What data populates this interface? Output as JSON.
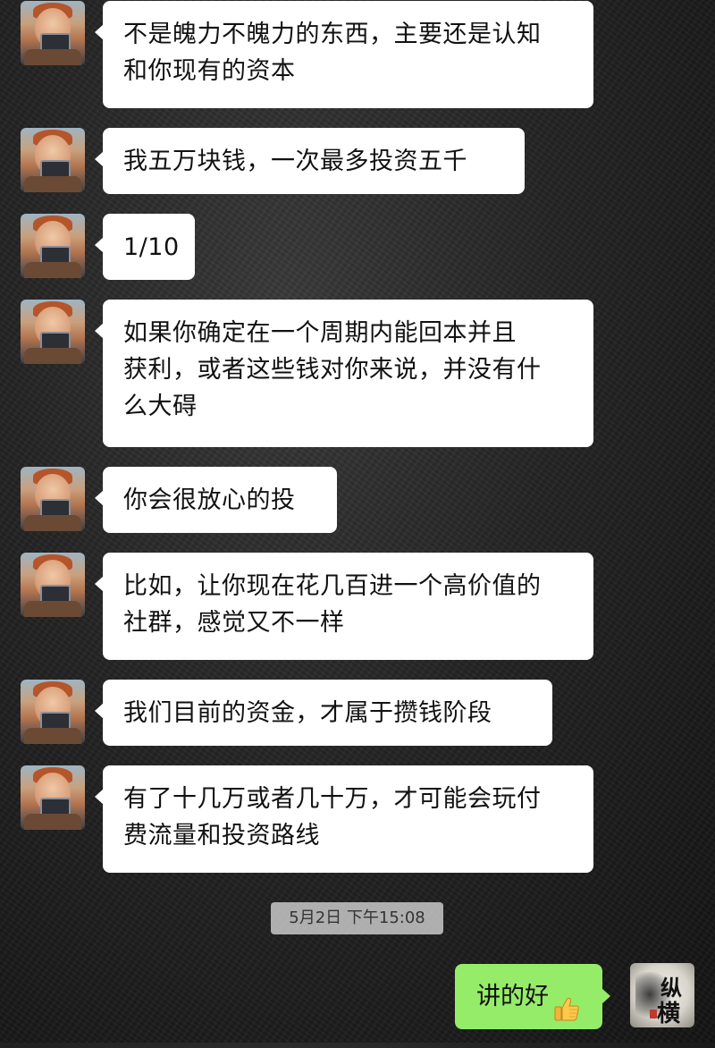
{
  "messages": [
    {
      "side": "left",
      "lines": [
        "不是魄力不魄力的东西，主要还是认知",
        "和你现有的资本"
      ]
    },
    {
      "side": "left",
      "lines": [
        "我五万块钱，一次最多投资五千"
      ]
    },
    {
      "side": "left",
      "lines": [
        "1/10"
      ]
    },
    {
      "side": "left",
      "lines": [
        "如果你确定在一个周期内能回本并且",
        "获利，或者这些钱对你来说，并没有什",
        "么大碍"
      ]
    },
    {
      "side": "left",
      "lines": [
        "你会很放心的投"
      ]
    },
    {
      "side": "left",
      "lines": [
        "比如，让你现在花几百进一个高价值的",
        "社群，感觉又不一样"
      ]
    },
    {
      "side": "left",
      "lines": [
        "我们目前的资金，才属于攒钱阶段"
      ]
    },
    {
      "side": "left",
      "lines": [
        "有了十几万或者几十万，才可能会玩付",
        "费流量和投资路线"
      ]
    }
  ],
  "timestamp": "5月2日 下午15:08",
  "sent_message": {
    "text": "讲的好",
    "emoji": "thumbs-up-icon"
  },
  "self_avatar": {
    "chars": [
      "纵",
      "横"
    ]
  },
  "colors": {
    "incoming_bubble": "#ffffff",
    "outgoing_bubble": "#95ec69",
    "timestamp_bg": "#c8c8c8"
  }
}
